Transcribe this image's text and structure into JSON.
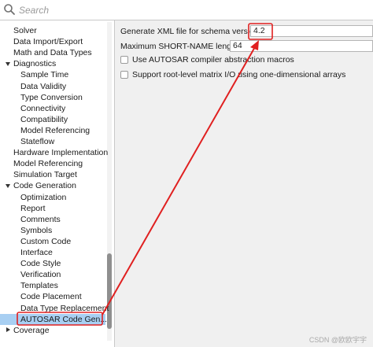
{
  "search": {
    "placeholder": "Search",
    "icon": "search-icon"
  },
  "sidebar": {
    "items": [
      {
        "label": "Solver",
        "level": 0
      },
      {
        "label": "Data Import/Export",
        "level": 0
      },
      {
        "label": "Math and Data Types",
        "level": 0
      },
      {
        "label": "Diagnostics",
        "level": 0,
        "expander": "expanded"
      },
      {
        "label": "Sample Time",
        "level": 1
      },
      {
        "label": "Data Validity",
        "level": 1
      },
      {
        "label": "Type Conversion",
        "level": 1
      },
      {
        "label": "Connectivity",
        "level": 1
      },
      {
        "label": "Compatibility",
        "level": 1
      },
      {
        "label": "Model Referencing",
        "level": 1
      },
      {
        "label": "Stateflow",
        "level": 1
      },
      {
        "label": "Hardware Implementation",
        "level": 0
      },
      {
        "label": "Model Referencing",
        "level": 0
      },
      {
        "label": "Simulation Target",
        "level": 0
      },
      {
        "label": "Code Generation",
        "level": 0,
        "expander": "expanded"
      },
      {
        "label": "Optimization",
        "level": 1
      },
      {
        "label": "Report",
        "level": 1
      },
      {
        "label": "Comments",
        "level": 1
      },
      {
        "label": "Symbols",
        "level": 1
      },
      {
        "label": "Custom Code",
        "level": 1
      },
      {
        "label": "Interface",
        "level": 1
      },
      {
        "label": "Code Style",
        "level": 1
      },
      {
        "label": "Verification",
        "level": 1
      },
      {
        "label": "Templates",
        "level": 1
      },
      {
        "label": "Code Placement",
        "level": 1
      },
      {
        "label": "Data Type Replacement",
        "level": 1
      },
      {
        "label": "AUTOSAR Code Gen...",
        "level": 1,
        "selected": true
      },
      {
        "label": "Coverage",
        "level": 0,
        "expander": "collapsed"
      }
    ]
  },
  "main": {
    "schema_label": "Generate XML file for schema version:",
    "schema_value": "4.2",
    "shortname_label": "Maximum SHORT-NAME length:",
    "shortname_value": "64",
    "checkbox1_label": "Use AUTOSAR compiler abstraction macros",
    "checkbox1_checked": false,
    "checkbox2_label": "Support root-level matrix I/O using one-dimensional arrays",
    "checkbox2_checked": false
  },
  "annotation": {
    "color": "#e02020"
  },
  "watermark": "CSDN @欧欧宇宇"
}
